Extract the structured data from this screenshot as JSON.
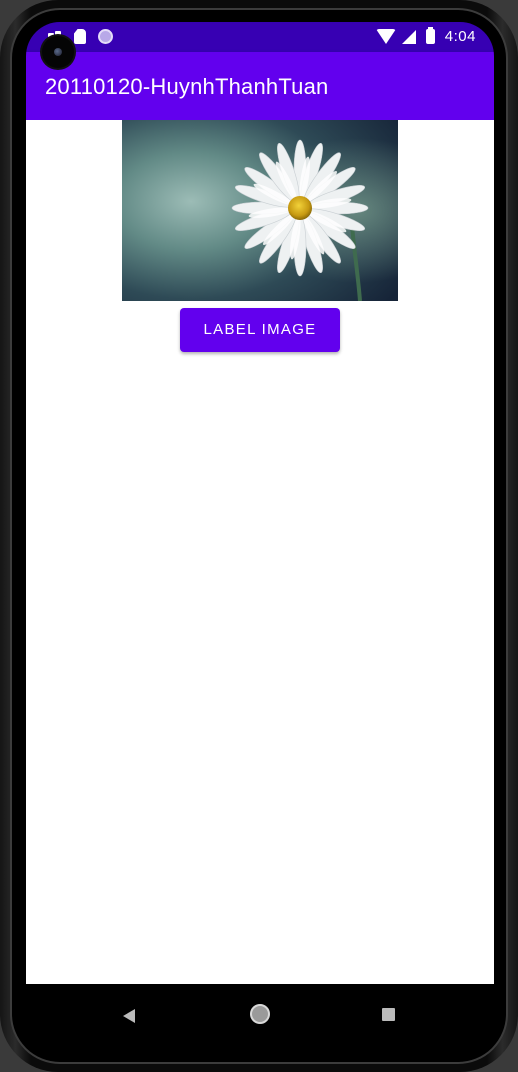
{
  "status_bar": {
    "time": "4:04",
    "icons": [
      "notification-icon",
      "sd-card-icon",
      "circle-status-icon",
      "wifi-icon",
      "signal-icon",
      "battery-icon"
    ]
  },
  "app_bar": {
    "title": "20110120-HuynhThanhTuan"
  },
  "main": {
    "image_name": "daisy-flower-image",
    "button_label": "LABEL IMAGE"
  },
  "nav_bar": {
    "icons": [
      "back-icon",
      "home-icon",
      "recent-apps-icon"
    ]
  },
  "colors": {
    "status_bar": "#3700b3",
    "primary": "#6200ee",
    "background": "#ffffff"
  }
}
